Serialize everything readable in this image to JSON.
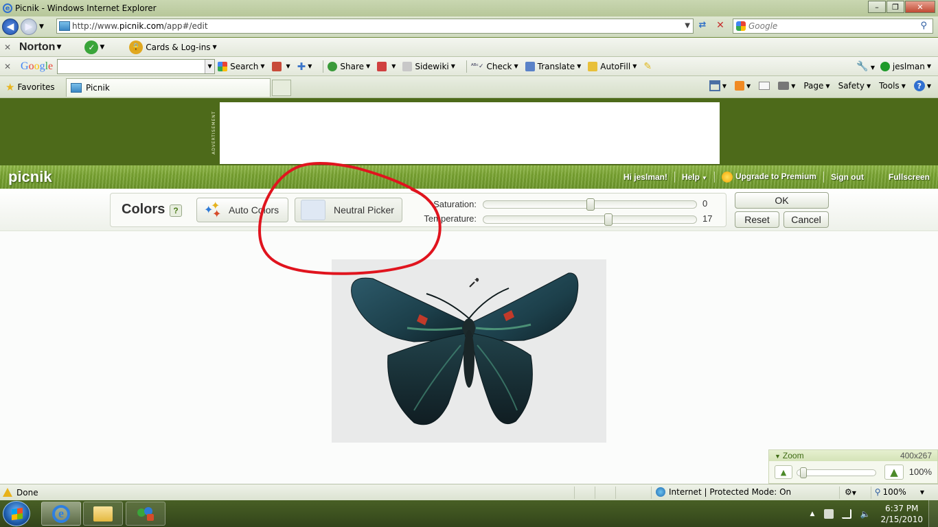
{
  "window": {
    "title": "Picnik - Windows Internet Explorer",
    "minimize": "–",
    "maximize": "❐",
    "close": "✕"
  },
  "address": {
    "url_prefix": "http://www.",
    "url_domain": "picnik.com",
    "url_path": "/app#/edit",
    "search_placeholder": "Google"
  },
  "norton": {
    "logo": "Norton",
    "cards_label": "Cards & Log-ins"
  },
  "google_toolbar": {
    "logo": [
      "G",
      "o",
      "o",
      "g",
      "l",
      "e"
    ],
    "items": [
      "Search",
      "Share",
      "Sidewiki",
      "Check",
      "Translate",
      "AutoFill"
    ],
    "user": "jeslman"
  },
  "favorites": {
    "label": "Favorites",
    "tab_title": "Picnik",
    "commands": [
      "Page",
      "Safety",
      "Tools"
    ]
  },
  "picnik": {
    "logo": "picnik",
    "ad_label": "ADVERTISEMENT",
    "links": {
      "greeting": "Hi jeslman!",
      "help": "Help",
      "upgrade": "Upgrade to Premium",
      "signout": "Sign out",
      "fullscreen": "Fullscreen"
    },
    "colors": {
      "title": "Colors",
      "help_q": "?",
      "auto_colors": "Auto Colors",
      "neutral_picker": "Neutral Picker",
      "saturation_label": "Saturation:",
      "saturation_value": "0",
      "saturation_level": 0.5,
      "temperature_label": "Temperature:",
      "temperature_value": "17",
      "temperature_level": 0.585,
      "ok": "OK",
      "reset": "Reset",
      "cancel": "Cancel"
    },
    "zoom": {
      "label": "Zoom",
      "dimensions": "400x267",
      "percent": "100%"
    }
  },
  "status": {
    "text": "Done",
    "zone": "Internet | Protected Mode: On",
    "zoom": "100%"
  },
  "taskbar": {
    "time": "6:37 PM",
    "date": "2/15/2010"
  },
  "colors": {
    "annotation": "#e0141e",
    "picnik_green": "#7aa532",
    "ad_green": "#4d6a1a"
  }
}
